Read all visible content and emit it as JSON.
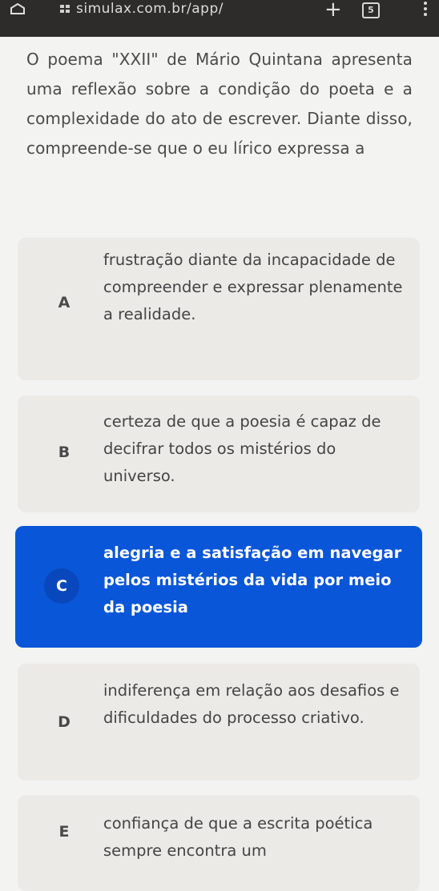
{
  "browser": {
    "url": "simulax.com.br/app/",
    "tab_count": "5"
  },
  "question": {
    "text": "O poema \"XXII\" de Mário Quintana apresenta uma reflexão sobre a condição do poeta e a complexidade do ato de escrever. Diante disso, compreende-se que o eu lírico expressa a"
  },
  "options": [
    {
      "letter": "A",
      "text": "frustração diante da incapacidade de compreender e expressar plenamente a realidade.",
      "selected": false
    },
    {
      "letter": "B",
      "text": "certeza de que a poesia é capaz de decifrar todos os mistérios do universo.",
      "selected": false
    },
    {
      "letter": "C",
      "text": "alegria e a satisfação em navegar pelos mistérios da vida por meio da poesia",
      "selected": true
    },
    {
      "letter": "D",
      "text": "indiferença em relação aos desafios e dificuldades do processo criativo.",
      "selected": false
    },
    {
      "letter": "E",
      "text": "confiança de que a escrita poética sempre encontra um",
      "selected": false
    }
  ],
  "colors": {
    "selected_bg": "#0a56d8",
    "option_bg": "#eceae7",
    "topbar_bg": "#2e2c2a"
  }
}
